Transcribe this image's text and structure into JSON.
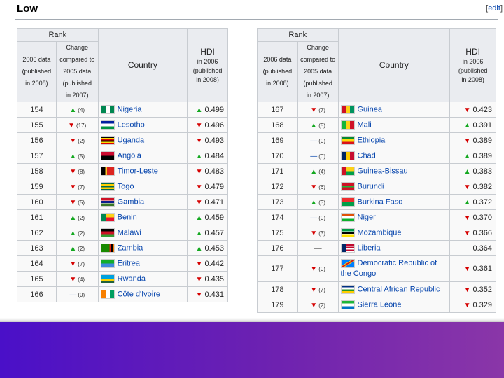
{
  "section": {
    "title": "Low",
    "edit_open": "[",
    "edit_label": "edit",
    "edit_close": "]"
  },
  "headers": {
    "rank": "Rank",
    "data_2006": [
      "2006 data",
      "(published",
      "in 2008)"
    ],
    "change": [
      "Change",
      "compared to",
      "2005 data",
      "(published",
      "in 2007)"
    ],
    "country": "Country",
    "hdi": "HDI",
    "hdi_sub": [
      "in 2006",
      "(published",
      "in 2008)"
    ]
  },
  "left_table": [
    {
      "rank": "154",
      "dir": "up",
      "change": "(4)",
      "flag": "nigeria-flag",
      "country": "Nigeria",
      "hdi_dir": "up",
      "hdi": "0.499"
    },
    {
      "rank": "155",
      "dir": "down",
      "change": "(17)",
      "flag": "lesotho-flag",
      "country": "Lesotho",
      "hdi_dir": "down",
      "hdi": "0.496"
    },
    {
      "rank": "156",
      "dir": "down",
      "change": "(2)",
      "flag": "uganda-flag",
      "country": "Uganda",
      "hdi_dir": "down",
      "hdi": "0.493"
    },
    {
      "rank": "157",
      "dir": "up",
      "change": "(5)",
      "flag": "angola-flag",
      "country": "Angola",
      "hdi_dir": "up",
      "hdi": "0.484"
    },
    {
      "rank": "158",
      "dir": "down",
      "change": "(8)",
      "flag": "timor-leste-flag",
      "country": "Timor-Leste",
      "hdi_dir": "down",
      "hdi": "0.483"
    },
    {
      "rank": "159",
      "dir": "down",
      "change": "(7)",
      "flag": "togo-flag",
      "country": "Togo",
      "hdi_dir": "down",
      "hdi": "0.479"
    },
    {
      "rank": "160",
      "dir": "down",
      "change": "(5)",
      "flag": "gambia-flag",
      "country": "Gambia",
      "hdi_dir": "down",
      "hdi": "0.471"
    },
    {
      "rank": "161",
      "dir": "up",
      "change": "(2)",
      "flag": "benin-flag",
      "country": "Benin",
      "hdi_dir": "up",
      "hdi": "0.459"
    },
    {
      "rank": "162",
      "dir": "up",
      "change": "(2)",
      "flag": "malawi-flag",
      "country": "Malawi",
      "hdi_dir": "up",
      "hdi": "0.457"
    },
    {
      "rank": "163",
      "dir": "up",
      "change": "(2)",
      "flag": "zambia-flag",
      "country": "Zambia",
      "hdi_dir": "up",
      "hdi": "0.453"
    },
    {
      "rank": "164",
      "dir": "down",
      "change": "(7)",
      "flag": "eritrea-flag",
      "country": "Eritrea",
      "hdi_dir": "down",
      "hdi": "0.442"
    },
    {
      "rank": "165",
      "dir": "down",
      "change": "(4)",
      "flag": "rwanda-flag",
      "country": "Rwanda",
      "hdi_dir": "down",
      "hdi": "0.435"
    },
    {
      "rank": "166",
      "dir": "same",
      "change": "(0)",
      "flag": "cote-divoire-flag",
      "country": "Côte d'Ivoire",
      "hdi_dir": "down",
      "hdi": "0.431"
    }
  ],
  "right_table": [
    {
      "rank": "167",
      "dir": "down",
      "change": "(7)",
      "flag": "guinea-flag",
      "country": "Guinea",
      "hdi_dir": "down",
      "hdi": "0.423"
    },
    {
      "rank": "168",
      "dir": "up",
      "change": "(5)",
      "flag": "mali-flag",
      "country": "Mali",
      "hdi_dir": "up",
      "hdi": "0.391"
    },
    {
      "rank": "169",
      "dir": "same",
      "change": "(0)",
      "flag": "ethiopia-flag",
      "country": "Ethiopia",
      "hdi_dir": "down",
      "hdi": "0.389"
    },
    {
      "rank": "170",
      "dir": "same",
      "change": "(0)",
      "flag": "chad-flag",
      "country": "Chad",
      "hdi_dir": "up",
      "hdi": "0.389"
    },
    {
      "rank": "171",
      "dir": "up",
      "change": "(4)",
      "flag": "guinea-bissau-flag",
      "country": "Guinea-Bissau",
      "hdi_dir": "up",
      "hdi": "0.383"
    },
    {
      "rank": "172",
      "dir": "down",
      "change": "(6)",
      "flag": "burundi-flag",
      "country": "Burundi",
      "hdi_dir": "down",
      "hdi": "0.382"
    },
    {
      "rank": "173",
      "dir": "up",
      "change": "(3)",
      "flag": "burkina-faso-flag",
      "country": "Burkina Faso",
      "hdi_dir": "up",
      "hdi": "0.372"
    },
    {
      "rank": "174",
      "dir": "same",
      "change": "(0)",
      "flag": "niger-flag",
      "country": "Niger",
      "hdi_dir": "down",
      "hdi": "0.370"
    },
    {
      "rank": "175",
      "dir": "down",
      "change": "(3)",
      "flag": "mozambique-flag",
      "country": "Mozambique",
      "hdi_dir": "down",
      "hdi": "0.366"
    },
    {
      "rank": "176",
      "dir": "none",
      "change": "—",
      "flag": "liberia-flag",
      "country": "Liberia",
      "hdi_dir": "none",
      "hdi": "0.364"
    },
    {
      "rank": "177",
      "dir": "down",
      "change": "(0)",
      "flag": "drc-flag",
      "country": "Democratic Republic of the Congo",
      "hdi_dir": "down",
      "hdi": "0.361",
      "wrap": true
    },
    {
      "rank": "178",
      "dir": "down",
      "change": "(7)",
      "flag": "car-flag",
      "country": "Central African Republic",
      "hdi_dir": "down",
      "hdi": "0.352"
    },
    {
      "rank": "179",
      "dir": "down",
      "change": "(2)",
      "flag": "sierra-leone-flag",
      "country": "Sierra Leone",
      "hdi_dir": "down",
      "hdi": "0.329"
    }
  ],
  "flag_styles": {
    "nigeria-flag": "linear-gradient(to right,#008751 33%,#ffffff 33%,#ffffff 66%,#008751 66%)",
    "lesotho-flag": "linear-gradient(to bottom,#00209f 33%,#ffffff 33%,#ffffff 66%,#009543 66%)",
    "uganda-flag": "linear-gradient(to bottom,#000 16%,#fcdc04 16%,#fcdc04 33%,#d90000 33%,#d90000 50%,#000 50%,#000 66%,#fcdc04 66%,#fcdc04 83%,#d90000 83%)",
    "angola-flag": "linear-gradient(to bottom,#cc092f 50%,#000 50%)",
    "timor-leste-flag": "linear-gradient(to right,#000 30%,#ffc726 30%,#ffc726 45%,#dc241f 45%)",
    "togo-flag": "linear-gradient(to bottom,#006a4e 20%,#ffce00 20%,#ffce00 40%,#006a4e 40%,#006a4e 60%,#ffce00 60%,#ffce00 80%,#006a4e 80%)",
    "gambia-flag": "linear-gradient(to bottom,#ce1126 33%,#fff 33%,#fff 38%,#0c1c8c 38%,#0c1c8c 62%,#fff 62%,#fff 67%,#3a7728 67%)",
    "benin-flag": "linear-gradient(to right,#008751 40%,transparent 40%),linear-gradient(to bottom,#fcd116 50%,#e8112d 50%)",
    "malawi-flag": "linear-gradient(to bottom,#000 33%,#ce1126 33%,#ce1126 66%,#339e35 66%)",
    "zambia-flag": "linear-gradient(to right,#198a00 65%,#de2010 65%,#de2010 77%,#000 77%,#000 89%,#ef7d00 89%)",
    "eritrea-flag": "linear-gradient(to bottom,#12ad2b 50%,#4189dd 50%)",
    "rwanda-flag": "linear-gradient(to bottom,#00a1de 50%,#fad201 50%,#fad201 75%,#20603d 75%)",
    "cote-divoire-flag": "linear-gradient(to right,#f77f00 33%,#ffffff 33%,#ffffff 66%,#009e60 66%)",
    "guinea-flag": "linear-gradient(to right,#ce1126 33%,#fcd116 33%,#fcd116 66%,#009460 66%)",
    "mali-flag": "linear-gradient(to right,#14b53a 33%,#fcd116 33%,#fcd116 66%,#ce1126 66%)",
    "ethiopia-flag": "linear-gradient(to bottom,#078930 33%,#fcdd09 33%,#fcdd09 66%,#da121a 66%)",
    "chad-flag": "linear-gradient(to right,#002664 33%,#fecb00 33%,#fecb00 66%,#c60c30 66%)",
    "guinea-bissau-flag": "linear-gradient(to right,#ce1126 33%,transparent 33%),linear-gradient(to bottom,#fcd116 50%,#009e49 50%)",
    "burundi-flag": "linear-gradient(to bottom,#ce1126 40%,#1eb53a 40%,#1eb53a 60%,#ce1126 60%)",
    "burkina-faso-flag": "linear-gradient(to bottom,#ef2b2d 50%,#009e49 50%)",
    "niger-flag": "linear-gradient(to bottom,#e05206 33%,#ffffff 33%,#ffffff 66%,#0db02b 66%)",
    "mozambique-flag": "linear-gradient(to bottom,#009a44 30%,#fff 30%,#fff 35%,#000 35%,#000 65%,#fff 65%,#fff 70%,#fce100 70%)",
    "liberia-flag": "linear-gradient(to right,#002868 40%,transparent 40%),linear-gradient(to bottom,#bf0a30 17%,#fff 17%,#fff 33%,#bf0a30 33%,#bf0a30 50%,#fff 50%,#fff 67%,#bf0a30 67%,#bf0a30 83%,#fff 83%)",
    "drc-flag": "linear-gradient(150deg,#007fff 40%,#f7d618 40%,#f7d618 45%,#ce1021 45%,#ce1021 55%,#f7d618 55%,#f7d618 60%,#007fff 60%)",
    "car-flag": "linear-gradient(to bottom,#003082 25%,#fff 25%,#fff 50%,#289728 50%,#289728 75%,#ffce00 75%)",
    "sierra-leone-flag": "linear-gradient(to bottom,#1eb53a 33%,#ffffff 33%,#ffffff 66%,#0072c6 66%)"
  },
  "arrows": {
    "up": "▲",
    "down": "▼",
    "same": "—",
    "none": ""
  }
}
